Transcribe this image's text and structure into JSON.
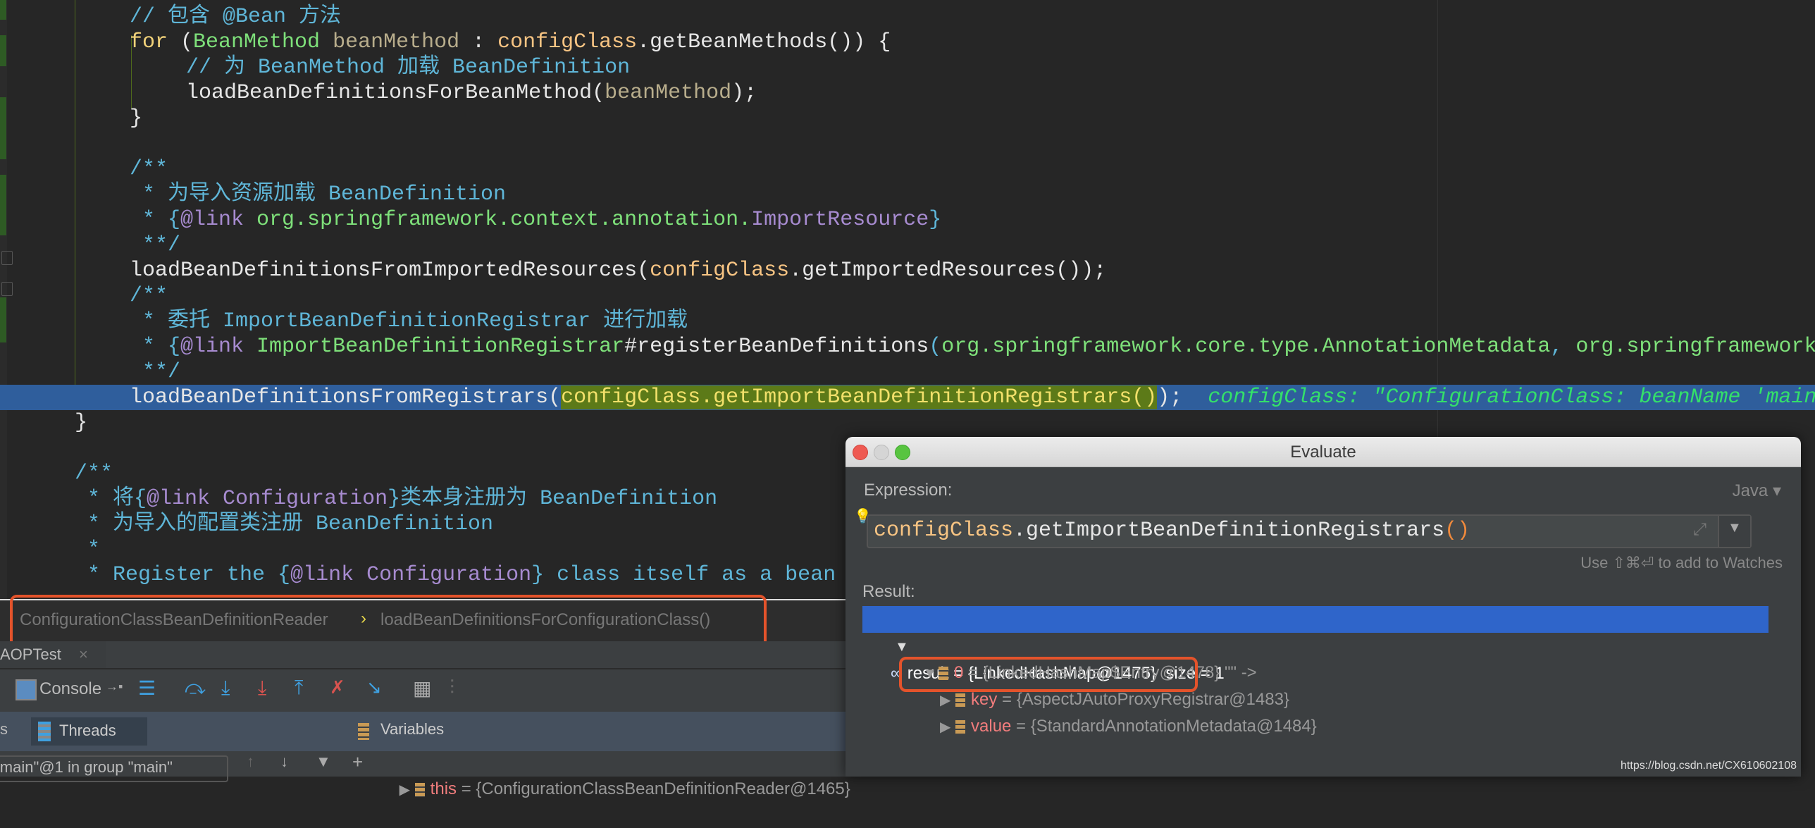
{
  "editor": {
    "lines": [
      {
        "segments": [
          {
            "t": "// 包含 @Bean 方法",
            "c": "c-com"
          }
        ],
        "indent": 1
      },
      {
        "segments": [
          {
            "t": "for",
            "c": "c-kw"
          },
          {
            "t": " ("
          },
          {
            "t": "BeanMethod",
            "c": "c-type"
          },
          {
            "t": " "
          },
          {
            "t": "beanMethod",
            "c": "c-var"
          },
          {
            "t": " : "
          },
          {
            "t": "configClass",
            "c": "c-field"
          },
          {
            "t": ".getBeanMethods()) {"
          }
        ],
        "indent": 1
      },
      {
        "segments": [
          {
            "t": "// 为 BeanMethod 加载 BeanDefinition",
            "c": "c-com"
          }
        ],
        "indent": 2
      },
      {
        "segments": [
          {
            "t": "loadBeanDefinitionsForBeanMethod("
          },
          {
            "t": "beanMethod",
            "c": "c-var"
          },
          {
            "t": ");"
          }
        ],
        "indent": 2
      },
      {
        "segments": [
          {
            "t": "}"
          }
        ],
        "indent": 1
      },
      {
        "segments": [],
        "indent": 1
      },
      {
        "segments": [
          {
            "t": "/**",
            "c": "c-com"
          }
        ],
        "indent": 1
      },
      {
        "segments": [
          {
            "t": " * 为导入资源加载 BeanDefinition",
            "c": "c-com"
          }
        ],
        "indent": 1
      },
      {
        "segments": [
          {
            "t": " * {",
            "c": "c-com"
          },
          {
            "t": "@link",
            "c": "c-tag"
          },
          {
            "t": " "
          },
          {
            "t": "org.springframework.context.annotation.",
            "c": "c-ref"
          },
          {
            "t": "ImportResource",
            "c": "c-tag"
          },
          {
            "t": "}",
            "c": "c-com"
          }
        ],
        "indent": 1
      },
      {
        "segments": [
          {
            "t": " **/",
            "c": "c-com"
          }
        ],
        "indent": 1
      },
      {
        "segments": [
          {
            "t": "loadBeanDefinitionsFromImportedResources("
          },
          {
            "t": "configClass",
            "c": "c-field"
          },
          {
            "t": ".getImportedResources());"
          }
        ],
        "indent": 1
      },
      {
        "segments": [
          {
            "t": "/**",
            "c": "c-com"
          }
        ],
        "indent": 1
      },
      {
        "segments": [
          {
            "t": " * 委托 ImportBeanDefinitionRegistrar 进行加载",
            "c": "c-com"
          }
        ],
        "indent": 1
      },
      {
        "segments": [
          {
            "t": " * {",
            "c": "c-com"
          },
          {
            "t": "@link",
            "c": "c-tag"
          },
          {
            "t": " "
          },
          {
            "t": "ImportBeanDefinitionRegistrar",
            "c": "c-ref"
          },
          {
            "t": "#registerBeanDefinitions"
          },
          {
            "t": "(",
            "c": "c-par"
          },
          {
            "t": "org.springframework.core.type.AnnotationMetadata",
            "c": "c-ref"
          },
          {
            "t": ", ",
            "c": "c-par"
          },
          {
            "t": "org.springframework.beans.factory.support.BeanDefinitionRegistry",
            "c": "c-ref"
          }
        ],
        "indent": 1
      },
      {
        "segments": [
          {
            "t": " **/",
            "c": "c-com"
          }
        ],
        "indent": 1
      },
      {
        "segments": [
          {
            "t": "loadBeanDefinitionsFromRegistrars("
          },
          {
            "t": "configClass.getImportBeanDefinitionRegistrars()",
            "c": "c-hl"
          },
          {
            "t": ");"
          },
          {
            "t": "  configClass: \"ConfigurationClass: beanName 'mainConfigOfAOP'\"",
            "c": "c-inline"
          }
        ],
        "indent": 1,
        "exec": true
      },
      {
        "segments": [
          {
            "t": "}"
          }
        ],
        "indent": 0
      },
      {
        "segments": [],
        "indent": 0
      },
      {
        "segments": [
          {
            "t": "/**",
            "c": "c-com"
          }
        ],
        "indent": 0
      },
      {
        "segments": [
          {
            "t": " * 将{",
            "c": "c-com"
          },
          {
            "t": "@link Configuration",
            "c": "c-tag"
          },
          {
            "t": "}类本身注册为 BeanDefinition",
            "c": "c-com"
          }
        ],
        "indent": 0
      },
      {
        "segments": [
          {
            "t": " * 为导入的配置类注册 BeanDefinition",
            "c": "c-com"
          }
        ],
        "indent": 0
      },
      {
        "segments": [
          {
            "t": " *",
            "c": "c-com"
          }
        ],
        "indent": 0
      },
      {
        "segments": [
          {
            "t": " * Register the {",
            "c": "c-com"
          },
          {
            "t": "@link Configuration",
            "c": "c-tag"
          },
          {
            "t": "} class itself as a bean definition.",
            "c": "c-com"
          }
        ],
        "indent": 0
      }
    ]
  },
  "breadcrumb": {
    "class_name": "ConfigurationClassBeanDefinitionReader",
    "separator": "›",
    "method_name": "loadBeanDefinitionsForConfigurationClass()"
  },
  "debug": {
    "run_tab": "AOPTest",
    "run_tab_close": "×",
    "console_label": "Console",
    "pin_glyph": "→▪",
    "frames_tab_suffix": "s",
    "threads_label": "Threads",
    "variables_label": "Variables",
    "thread_selector": "\"main\"@1 in group \"main\"",
    "this_var_name": "this",
    "this_var_value": " = {ConfigurationClassBeanDefinitionReader@1465}"
  },
  "evaluate": {
    "title": "Evaluate",
    "expression_label": "Expression:",
    "language": "Java",
    "expression_field": "configClass.getImportBeanDefinitionRegistrars()",
    "expression_field_object": "configClass",
    "expression_field_method": ".getImportBeanDefinitionRegistrars",
    "expression_field_parens": "()",
    "watches_hint": "Use ⇧⌘⏎ to add to Watches",
    "result_label": "Result:",
    "result": {
      "name": "result",
      "value": " = {LinkedHashMap@1475}  size = 1",
      "children": [
        {
          "name": "0",
          "value": " = {LinkedHashMap$Entry@1478} \"\" ->"
        },
        {
          "name": "key",
          "value": " = {AspectJAutoProxyRegistrar@1483}"
        },
        {
          "name": "value",
          "value": " = {StandardAnnotationMetadata@1484}"
        }
      ]
    }
  },
  "watermark": "https://blog.csdn.net/CX610602108",
  "colors": {
    "editor_bg": "#262626",
    "exec_line": "#2f5e9c",
    "selection": "#2f65ca",
    "annotation_box": "#e4532b"
  }
}
